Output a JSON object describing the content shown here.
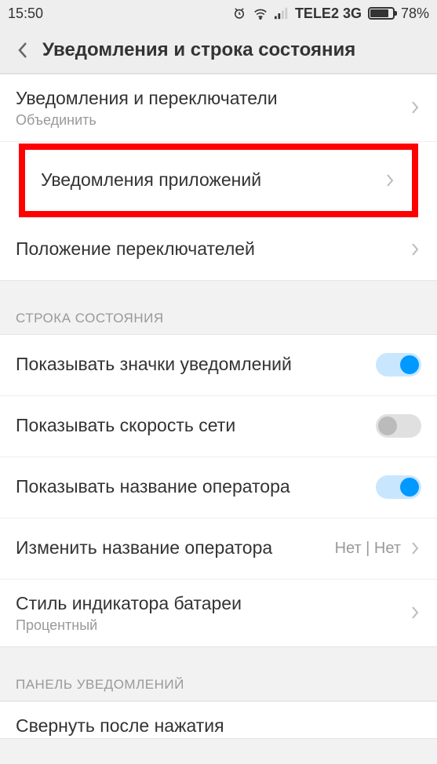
{
  "status": {
    "time": "15:50",
    "carrier": "TELE2 3G",
    "battery_pct": "78%"
  },
  "header": {
    "title": "Уведомления и строка состояния"
  },
  "group1": {
    "item0": {
      "title": "Уведомления и переключатели",
      "sub": "Объединить"
    },
    "item1": {
      "title": "Уведомления приложений"
    },
    "item2": {
      "title": "Положение переключателей"
    }
  },
  "section_status": {
    "header": "СТРОКА СОСТОЯНИЯ",
    "item0": {
      "title": "Показывать значки уведомлений"
    },
    "item1": {
      "title": "Показывать скорость сети"
    },
    "item2": {
      "title": "Показывать название оператора"
    },
    "item3": {
      "title": "Изменить название оператора",
      "value": "Нет | Нет"
    },
    "item4": {
      "title": "Стиль индикатора батареи",
      "sub": "Процентный"
    }
  },
  "section_panel": {
    "header": "ПАНЕЛЬ УВЕДОМЛЕНИЙ",
    "item0": {
      "title": "Свернуть после нажатия"
    }
  }
}
